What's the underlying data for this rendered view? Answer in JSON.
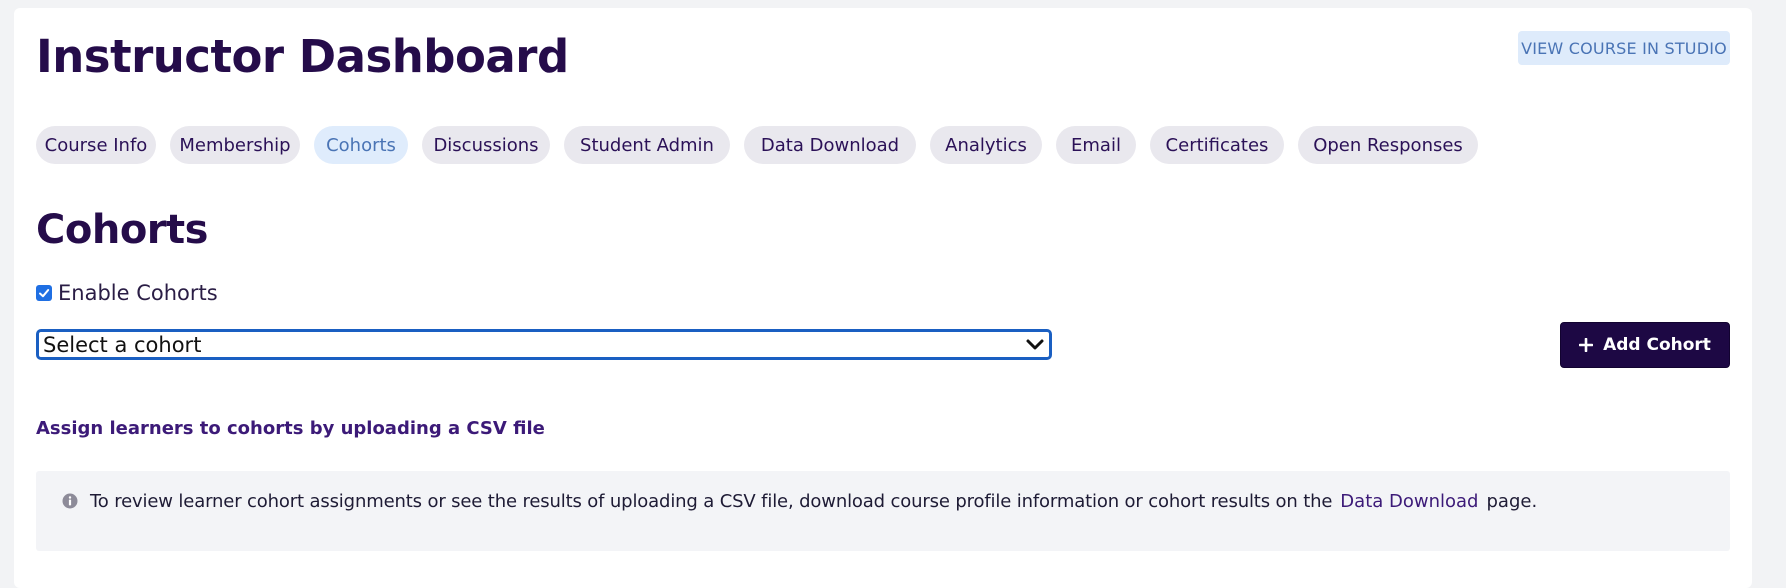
{
  "header": {
    "title": "Instructor Dashboard",
    "studio_button": "VIEW COURSE IN STUDIO"
  },
  "tabs": [
    {
      "label": "Course Info",
      "active": false
    },
    {
      "label": "Membership",
      "active": false
    },
    {
      "label": "Cohorts",
      "active": true
    },
    {
      "label": "Discussions",
      "active": false
    },
    {
      "label": "Student Admin",
      "active": false
    },
    {
      "label": "Data Download",
      "active": false
    },
    {
      "label": "Analytics",
      "active": false
    },
    {
      "label": "Email",
      "active": false
    },
    {
      "label": "Certificates",
      "active": false
    },
    {
      "label": "Open Responses",
      "active": false
    }
  ],
  "cohorts": {
    "title": "Cohorts",
    "enable_label": "Enable Cohorts",
    "enable_checked": true,
    "select_value": "Select a cohort",
    "add_button": "Add Cohort",
    "csv_link": "Assign learners to cohorts by uploading a CSV file",
    "info": {
      "text_before": "To review learner cohort assignments or see the results of uploading a CSV file, download course profile information or cohort results on the",
      "link": "Data Download",
      "text_after": "page."
    }
  },
  "colors": {
    "brand_dark": "#250c4a",
    "primary_button": "#1d0844",
    "active_tab_bg": "#dfecfc",
    "tab_bg": "#e9e8ee",
    "select_border": "#1a5fc2"
  },
  "icons": {
    "select_chevron": "chevron-down-icon",
    "add": "plus-icon",
    "info": "info-icon",
    "checkbox": "checkmark-icon"
  }
}
